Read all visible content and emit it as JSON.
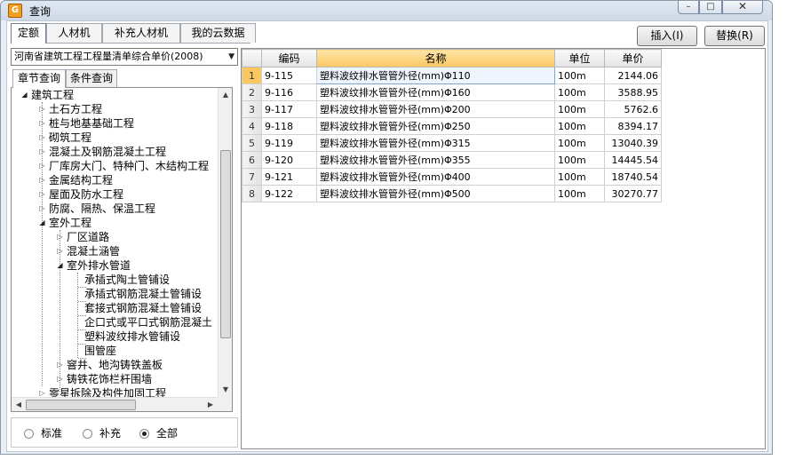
{
  "window": {
    "title": "查询",
    "min_glyph": "–",
    "max_glyph": "□",
    "close_glyph": "✕"
  },
  "tabs": [
    {
      "label": "定额"
    },
    {
      "label": "人材机"
    },
    {
      "label": "补充人材机"
    },
    {
      "label": "我的云数据"
    }
  ],
  "actions": {
    "insert_label": "插入(I)",
    "replace_label": "替换(R)"
  },
  "left": {
    "selected_library": "河南省建筑工程工程量清单综合单价(2008)",
    "subtabs": [
      {
        "label": "章节查询"
      },
      {
        "label": "条件查询"
      }
    ],
    "tree": [
      {
        "label": "建筑工程"
      },
      {
        "label": "土石方工程"
      },
      {
        "label": "桩与地基基础工程"
      },
      {
        "label": "砌筑工程"
      },
      {
        "label": "混凝土及钢筋混凝土工程"
      },
      {
        "label": "厂库房大门、特种门、木结构工程"
      },
      {
        "label": "金属结构工程"
      },
      {
        "label": "屋面及防水工程"
      },
      {
        "label": "防腐、隔热、保温工程"
      },
      {
        "label": "室外工程"
      },
      {
        "label": "厂区道路"
      },
      {
        "label": "混凝土涵管"
      },
      {
        "label": "室外排水管道"
      },
      {
        "label": "承插式陶土管铺设"
      },
      {
        "label": "承插式钢筋混凝土管铺设"
      },
      {
        "label": "套接式钢筋混凝土管铺设"
      },
      {
        "label": "企口式或平口式钢筋混凝土"
      },
      {
        "label": "塑料波纹排水管铺设"
      },
      {
        "label": "围管座"
      },
      {
        "label": "窨井、地沟铸铁盖板"
      },
      {
        "label": "铸铁花饰栏杆围墙"
      },
      {
        "label": "零星拆除及构件加固工程"
      }
    ],
    "radios": [
      {
        "label": "标准",
        "checked": false
      },
      {
        "label": "补充",
        "checked": false
      },
      {
        "label": "全部",
        "checked": true
      }
    ]
  },
  "grid": {
    "columns": [
      "编码",
      "名称",
      "单位",
      "单价"
    ],
    "rows": [
      {
        "no": "1",
        "code": "9-115",
        "name": "塑料波纹排水管管外径(mm)Φ110",
        "unit": "100m",
        "price": "2144.06"
      },
      {
        "no": "2",
        "code": "9-116",
        "name": "塑料波纹排水管管外径(mm)Φ160",
        "unit": "100m",
        "price": "3588.95"
      },
      {
        "no": "3",
        "code": "9-117",
        "name": "塑料波纹排水管管外径(mm)Φ200",
        "unit": "100m",
        "price": "5762.6"
      },
      {
        "no": "4",
        "code": "9-118",
        "name": "塑料波纹排水管管外径(mm)Φ250",
        "unit": "100m",
        "price": "8394.17"
      },
      {
        "no": "5",
        "code": "9-119",
        "name": "塑料波纹排水管管外径(mm)Φ315",
        "unit": "100m",
        "price": "13040.39"
      },
      {
        "no": "6",
        "code": "9-120",
        "name": "塑料波纹排水管管外径(mm)Φ355",
        "unit": "100m",
        "price": "14445.54"
      },
      {
        "no": "7",
        "code": "9-121",
        "name": "塑料波纹排水管管外径(mm)Φ400",
        "unit": "100m",
        "price": "18740.54"
      },
      {
        "no": "8",
        "code": "9-122",
        "name": "塑料波纹排水管管外径(mm)Φ500",
        "unit": "100m",
        "price": "30270.77"
      }
    ]
  }
}
